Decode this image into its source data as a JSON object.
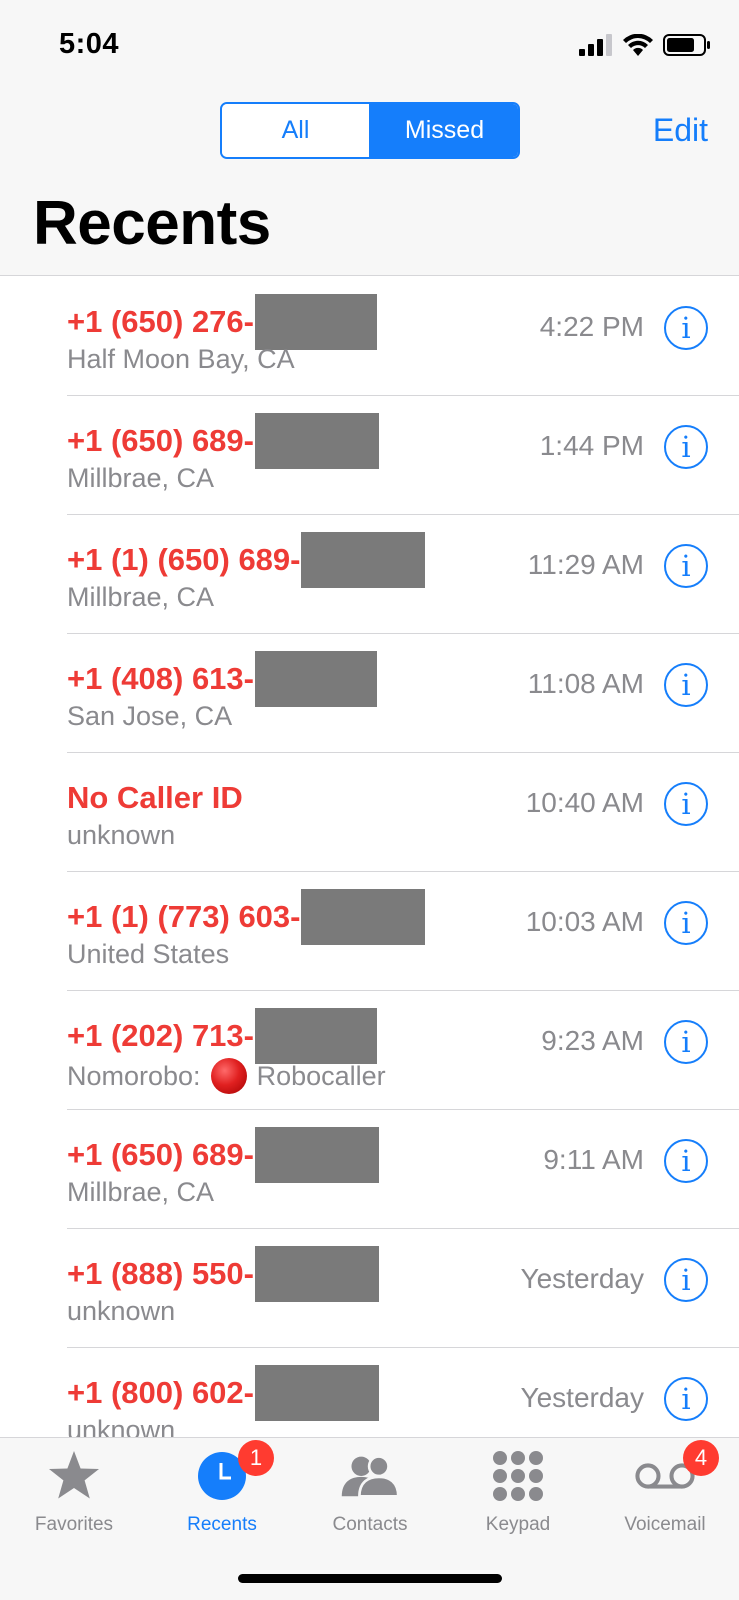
{
  "status_bar": {
    "time": "5:04"
  },
  "header": {
    "segments": [
      {
        "label": "All",
        "active": false
      },
      {
        "label": "Missed",
        "active": true
      }
    ],
    "edit_label": "Edit",
    "title": "Recents"
  },
  "calls": [
    {
      "number": "+1 (650) 276-",
      "subtitle": "Half Moon Bay, CA",
      "time": "4:22 PM"
    },
    {
      "number": "+1 (650) 689-",
      "subtitle": "Millbrae, CA",
      "time": "1:44 PM"
    },
    {
      "number": "+1 (1) (650) 689-",
      "subtitle": "Millbrae, CA",
      "time": "11:29 AM"
    },
    {
      "number": "+1 (408) 613-",
      "subtitle": "San Jose, CA",
      "time": "11:08 AM"
    },
    {
      "number": "No Caller ID",
      "subtitle": "unknown",
      "time": "10:40 AM"
    },
    {
      "number": "+1 (1) (773) 603-",
      "subtitle": "United States",
      "time": "10:03 AM"
    },
    {
      "number": "+1 (202) 713-",
      "subtitle_prefix": "Nomorobo:",
      "subtitle_suffix": "Robocaller",
      "time": "9:23 AM"
    },
    {
      "number": "+1 (650) 689-",
      "subtitle": "Millbrae, CA",
      "time": "9:11 AM"
    },
    {
      "number": "+1 (888) 550-",
      "subtitle": "unknown",
      "time": "Yesterday"
    },
    {
      "number": "+1 (800) 602-",
      "subtitle": "unknown",
      "time": "Yesterday"
    }
  ],
  "info_icon_glyph": "i",
  "tabbar": {
    "tabs": [
      {
        "label": "Favorites",
        "icon": "star-icon"
      },
      {
        "label": "Recents",
        "icon": "clock-icon",
        "badge": "1",
        "active": true
      },
      {
        "label": "Contacts",
        "icon": "contacts-icon"
      },
      {
        "label": "Keypad",
        "icon": "keypad-icon"
      },
      {
        "label": "Voicemail",
        "icon": "voicemail-icon",
        "badge": "4"
      }
    ]
  },
  "colors": {
    "accent": "#157efb",
    "missed": "#ee3b36",
    "badge": "#ff3b30",
    "secondary_text": "#8a8a8e",
    "redaction": "#7a7a7a"
  }
}
